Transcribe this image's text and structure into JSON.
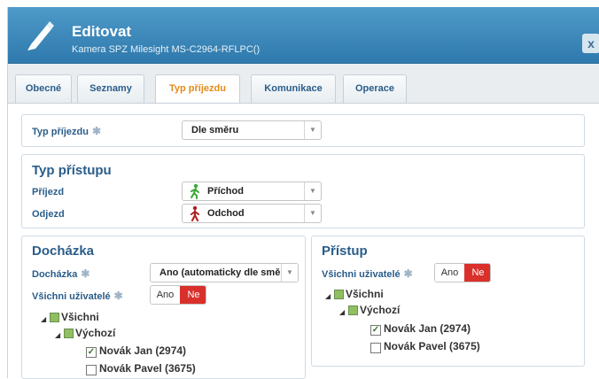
{
  "title": {
    "main": "Editovat",
    "subtitle": "Kamera SPZ Milesight MS-C2964-RFLPC()",
    "close": "x"
  },
  "tabs": [
    {
      "label": "Obecné"
    },
    {
      "label": "Seznamy"
    },
    {
      "label": "Typ příjezdu",
      "active": true
    },
    {
      "label": "Komunikace"
    },
    {
      "label": "Operace"
    }
  ],
  "arrival_type": {
    "label": "Typ příjezdu",
    "value": "Dle směru"
  },
  "access_type": {
    "title": "Typ přístupu",
    "arrival": {
      "label": "Příjezd",
      "value": "Příchod",
      "icon": "walk-in-icon"
    },
    "departure": {
      "label": "Odjezd",
      "value": "Odchod",
      "icon": "walk-out-icon"
    }
  },
  "attendance": {
    "title": "Docházka",
    "field_label": "Docházka",
    "field_value": "Ano (automaticky dle směru)",
    "all_users_label": "Všichni uživatelé",
    "toggle": {
      "yes": "Ano",
      "no": "Ne",
      "selected": "Ne"
    },
    "tree": {
      "root": "Všichni",
      "group": "Výchozí",
      "users": [
        {
          "name": "Novák Jan (2974)",
          "checked": true
        },
        {
          "name": "Novák Pavel (3675)",
          "checked": false
        }
      ]
    }
  },
  "access": {
    "title": "Přístup",
    "all_users_label": "Všichni uživatelé",
    "toggle": {
      "yes": "Ano",
      "no": "Ne",
      "selected": "Ne"
    },
    "tree": {
      "root": "Všichni",
      "group": "Výchozí",
      "users": [
        {
          "name": "Novák Jan (2974)",
          "checked": true
        },
        {
          "name": "Novák Pavel (3675)",
          "checked": false
        }
      ]
    }
  },
  "colors": {
    "accent": "#2f79ad",
    "label": "#2a5d8a",
    "active_tab": "#e38a1a",
    "toggle_on": "#d9302b",
    "arrival_icon": "#3aa935",
    "departure_icon": "#b01e1e"
  }
}
